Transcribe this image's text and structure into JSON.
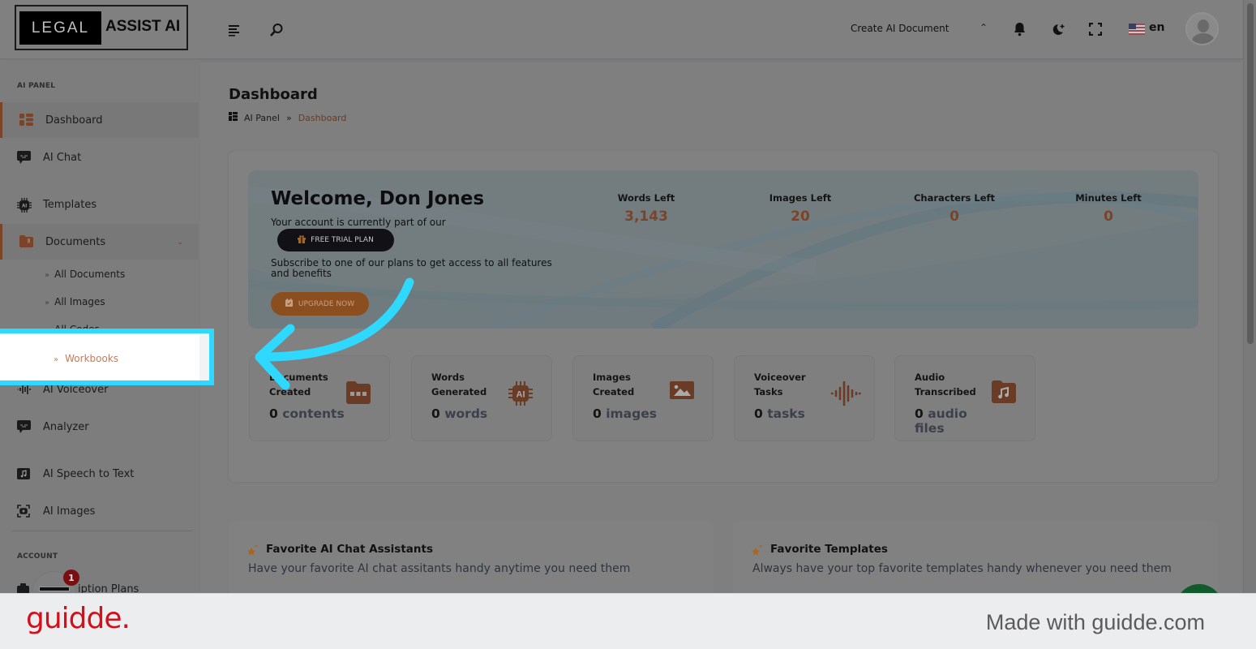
{
  "header": {
    "logo_left": "LEGAL",
    "logo_right": "ASSIST AI",
    "create_document": "Create AI Document",
    "language": "en",
    "icons": [
      "menu-icon",
      "search-icon",
      "chevron-up-icon",
      "bell-icon",
      "dark-mode-icon",
      "fullscreen-icon",
      "us-flag-icon",
      "user-avatar-icon"
    ]
  },
  "sidebar": {
    "section_ai_panel": "AI PANEL",
    "items": [
      {
        "label": "Dashboard",
        "icon": "dashboard-icon",
        "active": true
      },
      {
        "label": "AI Chat",
        "icon": "chat-icon"
      },
      {
        "label": "Templates",
        "icon": "ai-chip-icon"
      },
      {
        "label": "Documents",
        "icon": "folder-icon",
        "expanded": true
      },
      {
        "label": "AI Voiceover",
        "icon": "waveform-icon"
      },
      {
        "label": "Analyzer",
        "icon": "chat-icon"
      },
      {
        "label": "AI Speech to Text",
        "icon": "music-folder-icon"
      },
      {
        "label": "AI Images",
        "icon": "camera-icon"
      }
    ],
    "documents_sub": [
      {
        "label": "All Documents"
      },
      {
        "label": "All Images"
      },
      {
        "label": "All Codes"
      },
      {
        "label": "Workbooks",
        "highlighted": true
      }
    ],
    "section_account": "ACCOUNT",
    "account_items": [
      {
        "label": "Subscription Plans",
        "visible_text": "iption Plans"
      }
    ],
    "notification_count": "1"
  },
  "main": {
    "page_title": "Dashboard",
    "breadcrumb": [
      "AI Panel",
      "Dashboard"
    ],
    "breadcrumb_separator": "»",
    "welcome": {
      "title": "Welcome, Don Jones",
      "account_text": "Your account is currently part of our",
      "plan": "FREE TRIAL PLAN",
      "subscribe_text": "Subscribe to one of our plans to get access to all features and benefits",
      "upgrade_button": "UPGRADE NOW"
    },
    "stats": [
      {
        "label": "Words Left",
        "value": "3,143"
      },
      {
        "label": "Images Left",
        "value": "20"
      },
      {
        "label": "Characters Left",
        "value": "0"
      },
      {
        "label": "Minutes Left",
        "value": "0"
      }
    ],
    "mini_cards": [
      {
        "title": "Documents Created",
        "count": "0",
        "unit": "contents",
        "icon": "folder-dots-icon"
      },
      {
        "title": "Words Generated",
        "count": "0",
        "unit": "words",
        "icon": "ai-chip-icon"
      },
      {
        "title": "Images Created",
        "count": "0",
        "unit": "images",
        "icon": "image-icon"
      },
      {
        "title": "Voiceover Tasks",
        "count": "0",
        "unit": "tasks",
        "icon": "waveform-icon"
      },
      {
        "title": "Audio Transcribed",
        "count": "0",
        "unit": "audio files",
        "icon": "music-folder-icon"
      }
    ],
    "favorites": [
      {
        "title": "Favorite AI Chat Assistants",
        "subtitle": "Have your favorite AI chat assitants handy anytime you need them"
      },
      {
        "title": "Favorite Templates",
        "subtitle": "Always have your top favorite templates handy whenever you need them"
      }
    ]
  },
  "footer": {
    "brand": "guidde.",
    "made_with": "Made with guidde.com"
  },
  "colors": {
    "accent_brown": "#7b4429",
    "highlight_cyan": "#2fd8ff",
    "guidde_red": "#d4111a"
  }
}
